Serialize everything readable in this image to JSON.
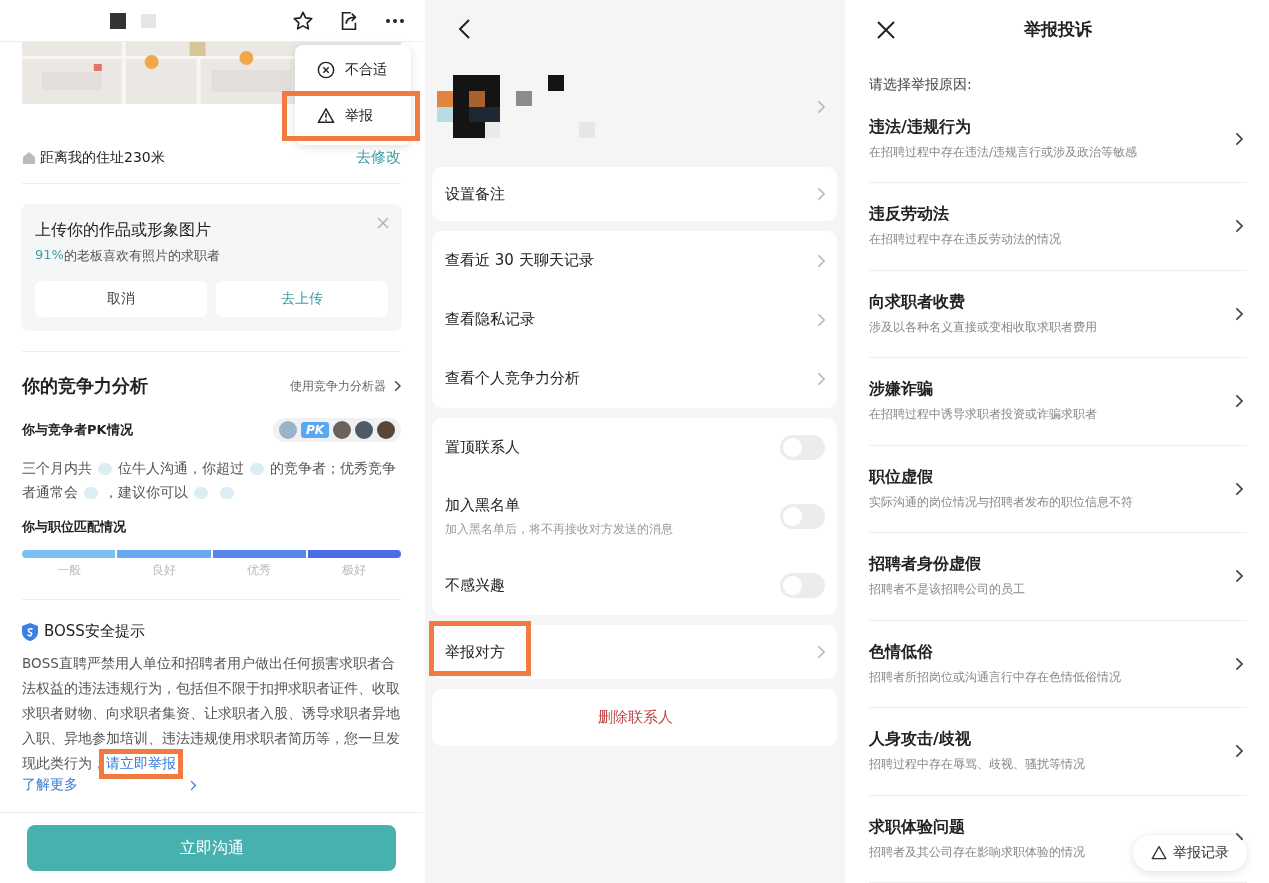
{
  "left": {
    "menu": {
      "items": [
        {
          "kind": "dismiss",
          "label": "不合适",
          "highlighted": false
        },
        {
          "kind": "report",
          "label": "举报",
          "highlighted": true
        }
      ]
    },
    "distance": {
      "text": "距离我的住址230米",
      "action": "去修改"
    },
    "upload": {
      "title": "上传你的作品或形象图片",
      "stat": "91%",
      "stat_text": "的老板喜欢有照片的求职者",
      "buttons": [
        {
          "label": "取消",
          "kind": "secondary"
        },
        {
          "label": "去上传",
          "kind": "primary"
        }
      ]
    },
    "analysis": {
      "title": "你的竞争力分析",
      "link": "使用竞争力分析器",
      "pk_label": "你与竞争者PK情况",
      "pk_badge": "PK",
      "summary": [
        {
          "kind": "text",
          "text": "三个月内共"
        },
        {
          "kind": "blur"
        },
        {
          "kind": "text",
          "text": "位牛人沟通，你超过"
        },
        {
          "kind": "blur"
        },
        {
          "kind": "text",
          "text": "的竞争者；优秀竞争者通常会"
        },
        {
          "kind": "blur"
        },
        {
          "kind": "text",
          "text": "，建议你可以"
        },
        {
          "kind": "blur"
        },
        {
          "kind": "blur"
        }
      ],
      "match_label": "你与职位匹配情况",
      "levels": [
        "一般",
        "良好",
        "优秀",
        "极好"
      ]
    },
    "safety": {
      "title": "BOSS安全提示",
      "text": "BOSS直聘严禁用人单位和招聘者用户做出任何损害求职者合法权益的违法违规行为，包括但不限于扣押求职者证件、收取求职者财物、向求职者集资、让求职者入股、诱导求职者异地入职、异地参加培训、违法违规使用求职者简历等，您一旦发现此类行为，",
      "report_link": "请立即举报",
      "report_link_highlighted": true,
      "more_link": "了解更多"
    },
    "cta": "立即沟通"
  },
  "middle": {
    "groups": [
      [
        {
          "kind": "link",
          "label": "设置备注",
          "highlighted": false
        }
      ],
      [
        {
          "kind": "link",
          "label": "查看近 30 天聊天记录",
          "highlighted": false
        },
        {
          "kind": "link",
          "label": "查看隐私记录",
          "highlighted": false
        },
        {
          "kind": "link",
          "label": "查看个人竞争力分析",
          "highlighted": false
        }
      ],
      [
        {
          "kind": "toggle",
          "label": "置顶联系人",
          "on": false
        },
        {
          "kind": "toggle",
          "label": "加入黑名单",
          "note": "加入黑名单后，将不再接收对方发送的消息",
          "on": false
        },
        {
          "kind": "toggle",
          "label": "不感兴趣",
          "on": false
        }
      ],
      [
        {
          "kind": "link",
          "label": "举报对方",
          "highlighted": true
        }
      ],
      [
        {
          "kind": "danger",
          "label": "删除联系人"
        }
      ]
    ]
  },
  "right": {
    "title": "举报投诉",
    "prompt": "请选择举报原因:",
    "reasons": [
      {
        "title": "违法/违规行为",
        "desc": "在招聘过程中存在违法/违规言行或涉及政治等敏感"
      },
      {
        "title": "违反劳动法",
        "desc": "在招聘过程中存在违反劳动法的情况"
      },
      {
        "title": "向求职者收费",
        "desc": "涉及以各种名义直接或变相收取求职者费用"
      },
      {
        "title": "涉嫌诈骗",
        "desc": "在招聘过程中诱导求职者投资或诈骗求职者"
      },
      {
        "title": "职位虚假",
        "desc": "实际沟通的岗位情况与招聘者发布的职位信息不符"
      },
      {
        "title": "招聘者身份虚假",
        "desc": "招聘者不是该招聘公司的员工"
      },
      {
        "title": "色情低俗",
        "desc": "招聘者所招岗位或沟通言行中存在色情低俗情况"
      },
      {
        "title": "人身攻击/歧视",
        "desc": "招聘过程中存在辱骂、歧视、骚扰等情况"
      },
      {
        "title": "求职体验问题",
        "desc": "招聘者及其公司存在影响求职体验的情况"
      }
    ],
    "records_button": "举报记录"
  }
}
